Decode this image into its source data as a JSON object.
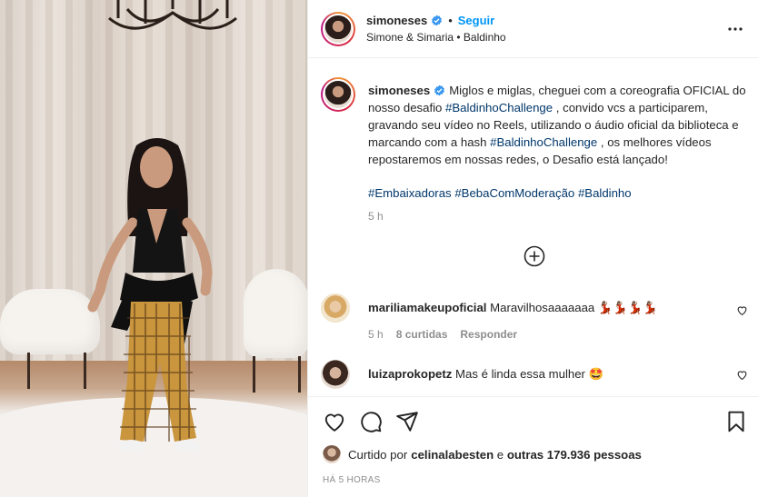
{
  "header": {
    "username": "simoneses",
    "separator": "•",
    "follow_label": "Seguir",
    "subtitle": "Simone & Simaria • Baldinho"
  },
  "caption": {
    "username": "simoneses",
    "text_1": "Miglos e miglas, cheguei com a coreografia OFICIAL do nosso desafio ",
    "tag_1": "#BaldinhoChallenge",
    "text_2": " , convido vcs a participarem, gravando seu vídeo no Reels, utilizando o áudio oficial da biblioteca e marcando com a hash ",
    "tag_2": "#BaldinhoChallenge",
    "text_3": " , os melhores vídeos repostaremos em nossas redes, o Desafio está lançado!",
    "tag_3": "#Embaixadoras",
    "tag_4": "#BebaComModeração",
    "tag_5": "#Baldinho",
    "time": "5 h"
  },
  "comments": [
    {
      "username": "mariliamakeupoficial",
      "text": "Maravilhosaaaaaaa 💃🏽💃🏽💃🏽💃🏽",
      "time": "5 h",
      "likes": "8 curtidas",
      "reply_label": "Responder"
    },
    {
      "username": "luizaprokopetz",
      "text": "Mas é linda essa mulher 🤩"
    }
  ],
  "likes": {
    "prefix": "Curtido por ",
    "user": "celinalabesten",
    "middle": " e ",
    "others": "outras 179.936 pessoas"
  },
  "posted_ago": "HÁ 5 HORAS",
  "icons": {
    "more": "more-options-icon",
    "verified": "verified-badge-icon",
    "load_more": "plus-circle-icon",
    "like": "heart-icon",
    "comment": "comment-icon",
    "share": "share-icon",
    "save": "bookmark-icon"
  },
  "colors": {
    "link": "#0095f6",
    "hashtag": "#00376b",
    "muted": "#8e8e8e"
  }
}
